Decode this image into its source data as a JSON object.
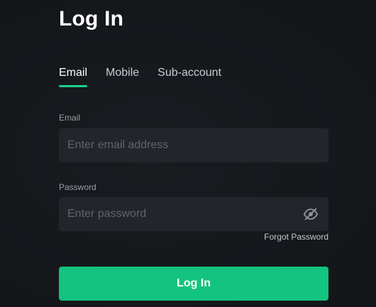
{
  "header": {
    "title": "Log In"
  },
  "tabs": [
    {
      "label": "Email",
      "active": true
    },
    {
      "label": "Mobile",
      "active": false
    },
    {
      "label": "Sub-account",
      "active": false
    }
  ],
  "form": {
    "email": {
      "label": "Email",
      "placeholder": "Enter email address",
      "value": ""
    },
    "password": {
      "label": "Password",
      "placeholder": "Enter password",
      "value": "",
      "toggle_icon": "eye-slash-icon"
    },
    "forgot_password": "Forgot Password",
    "submit_label": "Log In"
  },
  "colors": {
    "accent": "#14c37f",
    "tab_underline": "#1fcf8c",
    "background": "#16191d",
    "input_background": "#22262c"
  }
}
